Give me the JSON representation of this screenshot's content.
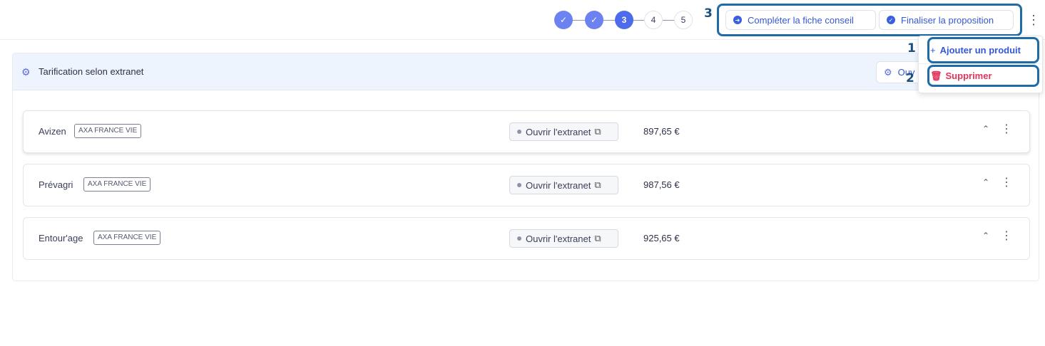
{
  "stepper": {
    "steps": [
      {
        "label": "✓",
        "state": "done"
      },
      {
        "label": "✓",
        "state": "done"
      },
      {
        "label": "3",
        "state": "current"
      },
      {
        "label": "4",
        "state": "todo"
      },
      {
        "label": "5",
        "state": "todo"
      }
    ]
  },
  "annotations": {
    "n1": "1",
    "n2": "2",
    "n3": "3"
  },
  "toolbar": {
    "complete_label": "Compléter la fiche conseil",
    "finalize_label": "Finaliser la proposition",
    "more_icon": "⋮"
  },
  "panel": {
    "title": "Tarification selon extranet",
    "open_button_label": "Ouv"
  },
  "products": [
    {
      "name": "Avizen",
      "insurer": "AXA FRANCE VIE",
      "extranet_label": "Ouvrir l'extranet",
      "price": "897,65 €"
    },
    {
      "name": "Prévagri",
      "insurer": "AXA FRANCE VIE",
      "extranet_label": "Ouvrir l'extranet",
      "price": "987,56 €"
    },
    {
      "name": "Entour'age",
      "insurer": "AXA FRANCE VIE",
      "extranet_label": "Ouvrir l'extranet",
      "price": "925,65 €"
    }
  ],
  "dropdown": {
    "add_label": "Ajouter un produit",
    "delete_label": "Supprimer"
  },
  "colors": {
    "accent": "#3558d8",
    "danger": "#e0345a",
    "annotation": "#1f6ba6",
    "header_bg": "#eef4fd"
  }
}
